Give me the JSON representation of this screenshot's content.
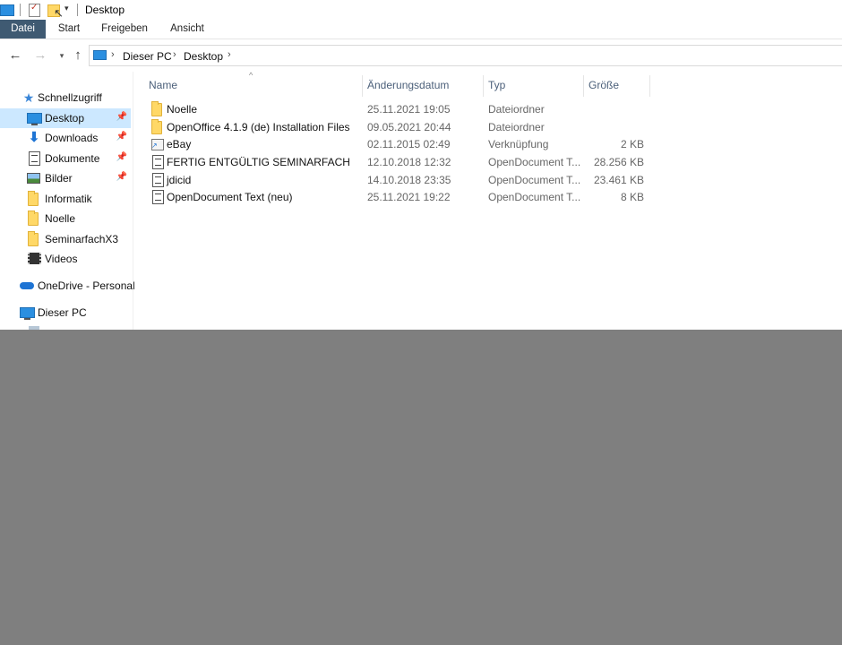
{
  "window": {
    "title": "Desktop"
  },
  "ribbon": {
    "tabs": [
      "Datei",
      "Start",
      "Freigeben",
      "Ansicht"
    ]
  },
  "address": {
    "crumbs": [
      "Dieser PC",
      "Desktop"
    ]
  },
  "nav": {
    "quick_access": "Schnellzugriff",
    "items": [
      {
        "label": "Desktop",
        "pinned": true,
        "icon": "desktop-icon"
      },
      {
        "label": "Downloads",
        "pinned": true,
        "icon": "download-arrow-icon"
      },
      {
        "label": "Dokumente",
        "pinned": true,
        "icon": "documents-icon"
      },
      {
        "label": "Bilder",
        "pinned": true,
        "icon": "pictures-icon"
      },
      {
        "label": "Informatik",
        "pinned": false,
        "icon": "folder-icon"
      },
      {
        "label": "Noelle",
        "pinned": false,
        "icon": "folder-icon"
      },
      {
        "label": "SeminarfachX3",
        "pinned": false,
        "icon": "folder-icon"
      },
      {
        "label": "Videos",
        "pinned": false,
        "icon": "videos-icon"
      }
    ],
    "onedrive": "OneDrive - Personal",
    "this_pc": "Dieser PC"
  },
  "list": {
    "columns": {
      "name": "Name",
      "date": "Änderungsdatum",
      "type": "Typ",
      "size": "Größe"
    },
    "rows": [
      {
        "name": "Noelle",
        "date": "25.11.2021 19:05",
        "type": "Dateiordner",
        "size": "",
        "icon": "folder-icon"
      },
      {
        "name": "OpenOffice 4.1.9 (de) Installation Files",
        "date": "09.05.2021 20:44",
        "type": "Dateiordner",
        "size": "",
        "icon": "folder-icon"
      },
      {
        "name": "eBay",
        "date": "02.11.2015 02:49",
        "type": "Verknüpfung",
        "size": "2 KB",
        "icon": "shortcut-icon"
      },
      {
        "name": "FERTIG ENTGÜLTIG SEMINARFACH",
        "date": "12.10.2018 12:32",
        "type": "OpenDocument T...",
        "size": "28.256 KB",
        "icon": "odt-document-icon"
      },
      {
        "name": "jdicid",
        "date": "14.10.2018 23:35",
        "type": "OpenDocument T...",
        "size": "23.461 KB",
        "icon": "odt-document-icon"
      },
      {
        "name": "OpenDocument Text (neu)",
        "date": "25.11.2021 19:22",
        "type": "OpenDocument T...",
        "size": "8 KB",
        "icon": "odt-document-icon"
      }
    ]
  },
  "colors": {
    "file_tab": "#3f5a72",
    "selection": "#cce8ff",
    "header_text": "#4c607a",
    "outside": "#7f7f7f"
  }
}
